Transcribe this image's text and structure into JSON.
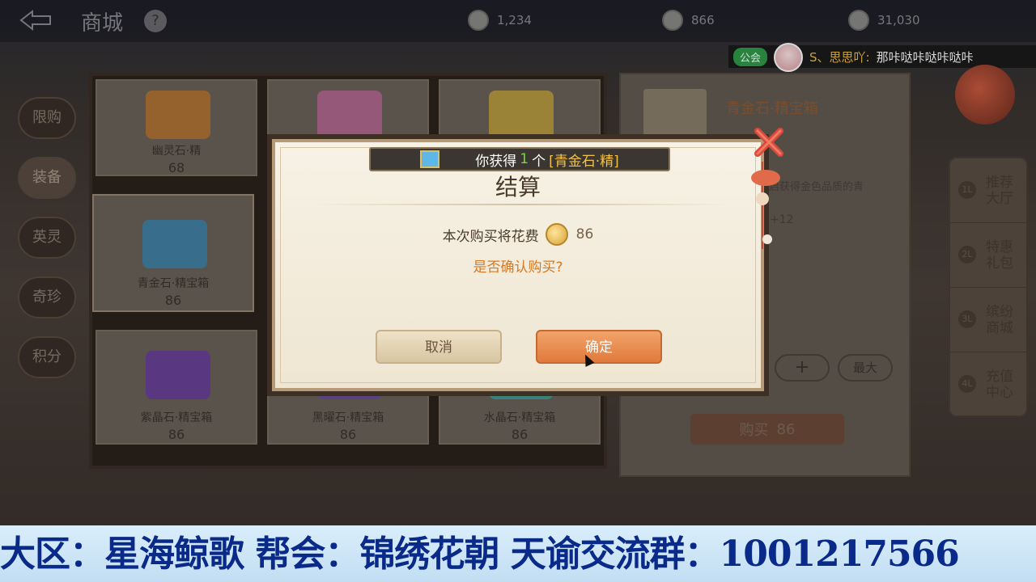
{
  "header": {
    "title": "商城",
    "help": "?"
  },
  "currencies": [
    {
      "value": "1,234"
    },
    {
      "value": "866"
    },
    {
      "value": "31,030"
    }
  ],
  "chat": {
    "tag": "公会",
    "name": "S、思思吖:",
    "message": "那咔哒咔哒咔哒咔"
  },
  "left_nav": [
    "限购",
    "装备",
    "英灵",
    "奇珍",
    "积分"
  ],
  "items": [
    {
      "name": "幽灵石·精",
      "price": "68",
      "color": "#c0782c"
    },
    {
      "name": "",
      "price": "",
      "color": "#c06a9a"
    },
    {
      "name": "",
      "price": "",
      "color": "#c8a83a"
    },
    {
      "name": "青金石·精宝箱",
      "price": "86",
      "color": "#3a8ab8"
    },
    {
      "name": "紫晶石·精宝箱",
      "price": "86",
      "color": "#6a3aa8"
    },
    {
      "name": "黑曜石·精宝箱",
      "price": "86",
      "color": "#6a4aa0"
    },
    {
      "name": "水晶石·精宝箱",
      "price": "86",
      "color": "#3aa89a"
    }
  ],
  "detail": {
    "title": "青金石·精宝箱",
    "desc": "开启获得金色品质的青",
    "bonus": "+12",
    "plus": "+",
    "max": "最大",
    "buy_label": "购买",
    "buy_price": "86"
  },
  "right_nav": [
    {
      "num": "1L",
      "label": "推荐大厅"
    },
    {
      "num": "2L",
      "label": "特惠礼包"
    },
    {
      "num": "3L",
      "label": "缤纷商城"
    },
    {
      "num": "4L",
      "label": "充值中心"
    }
  ],
  "dialog": {
    "banner_prefix": "你获得",
    "banner_count": "1",
    "banner_unit": "个",
    "banner_item": "[青金石·精]",
    "title": "结算",
    "cost_text": "本次购买将花费",
    "cost_amount": "86",
    "question": "是否确认购买?",
    "cancel": "取消",
    "confirm": "确定"
  },
  "footer": {
    "text": "大区：星海鲸歌 帮会：锦绣花朝 天谕交流群：1001217566"
  },
  "colors": {
    "confirm": "#e07a3c",
    "accent_gold": "#f0c24a",
    "footer_text": "#0a2a8a"
  }
}
